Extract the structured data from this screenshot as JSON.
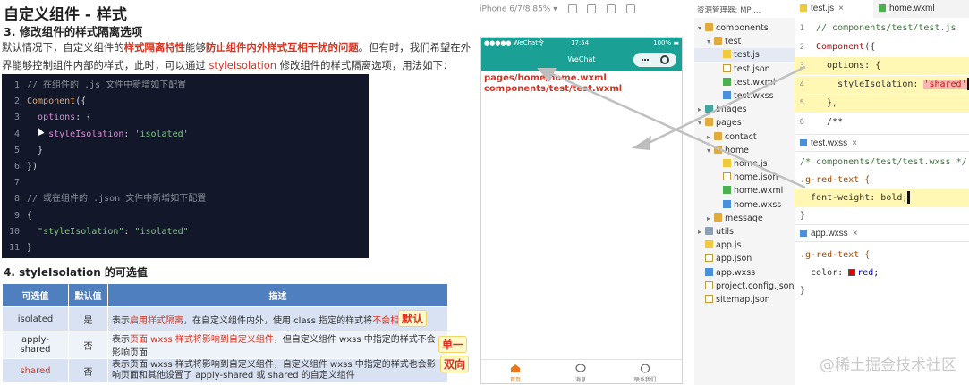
{
  "slide": {
    "title": "自定义组件 - 样式",
    "section3": "3. 修改组件的样式隔离选项",
    "para_a": "默认情况下，自定义组件的",
    "para_hl1": "样式隔离特性",
    "para_b": "能够",
    "para_hl2": "防止组件内外样式互相干扰的问题",
    "para_c": "。但有时，我们希望在外界能够控制组件内部的样式，此时，可以通过 ",
    "para_hl3": "styleIsolation",
    "para_d": " 修改组件的样式隔离选项，用法如下：",
    "code_lines": [
      {
        "n": "1",
        "parts": [
          {
            "c": "tk-cm",
            "t": "// 在组件的 .js 文件中新增如下配置"
          }
        ]
      },
      {
        "n": "2",
        "parts": [
          {
            "c": "tk-kw",
            "t": "Component"
          },
          {
            "c": "tk-pl",
            "t": "({"
          }
        ]
      },
      {
        "n": "3",
        "parts": [
          {
            "c": "tk-pl",
            "t": "  "
          },
          {
            "c": "tk-prop",
            "t": "options"
          },
          {
            "c": "tk-pl",
            "t": ": {"
          }
        ]
      },
      {
        "n": "4",
        "parts": [
          {
            "c": "tk-pl",
            "t": "    "
          },
          {
            "c": "tk-prop",
            "t": "styleIsolation"
          },
          {
            "c": "tk-pl",
            "t": ": "
          },
          {
            "c": "tk-str",
            "t": "'isolated'"
          }
        ]
      },
      {
        "n": "5",
        "parts": [
          {
            "c": "tk-pl",
            "t": "  }"
          }
        ]
      },
      {
        "n": "6",
        "parts": [
          {
            "c": "tk-pl",
            "t": "})"
          }
        ]
      },
      {
        "n": "7",
        "parts": []
      },
      {
        "n": "8",
        "parts": [
          {
            "c": "tk-cm",
            "t": "// 或在组件的 .json 文件中新增如下配置"
          }
        ]
      },
      {
        "n": "9",
        "parts": [
          {
            "c": "tk-pl",
            "t": "{"
          }
        ]
      },
      {
        "n": "10",
        "parts": [
          {
            "c": "tk-pl",
            "t": "  "
          },
          {
            "c": "tk-str",
            "t": "\"styleIsolation\""
          },
          {
            "c": "tk-pl",
            "t": ": "
          },
          {
            "c": "tk-str",
            "t": "\"isolated\""
          }
        ]
      },
      {
        "n": "11",
        "parts": [
          {
            "c": "tk-pl",
            "t": "}"
          }
        ]
      }
    ],
    "section4": "4. styleIsolation 的可选值",
    "table": {
      "headers": [
        "可选值",
        "默认值",
        "描述"
      ],
      "rows": [
        {
          "value": "isolated",
          "default": "是",
          "desc_a": "表示",
          "desc_red1": "启用样式隔离",
          "desc_b": "，在自定义组件内外，使用 class 指定的样式将",
          "desc_red2": "不会相互影响",
          "tag": "默认"
        },
        {
          "value": "apply-shared",
          "default": "否",
          "desc_a": "表示",
          "desc_red1": "页面 wxss 样式将影响到自定义组件",
          "desc_b": "，但自定义组件 wxss 中指定的样式不会影响页面",
          "desc_red2": "",
          "tag": "单一"
        },
        {
          "value": "shared",
          "default": "否",
          "desc_a": "表示页面 wxss 样式将影响到自定义组件，自定义组件 wxss 中指定的样式也会影响页面和其他设置了 apply-shared 或 shared 的自定义组件",
          "desc_red1": "",
          "desc_b": "",
          "desc_red2": "",
          "tag": "双向"
        }
      ]
    }
  },
  "simulator": {
    "device": "iPhone 6/7/8 85% ▾",
    "status_left": "●●●●● WeChat令",
    "status_time": "17:54",
    "status_right": "100% ▬",
    "nav_title": "WeChat",
    "line1": "pages/home/home.wxml",
    "line2": "components/test/test.wxml",
    "tabs": [
      {
        "label": "首页",
        "icon": "home-icon",
        "active": true
      },
      {
        "label": "消息",
        "icon": "message-icon",
        "active": false
      },
      {
        "label": "联系我们",
        "icon": "phone-icon",
        "active": false
      }
    ]
  },
  "tree": {
    "header": "资源管理器: MP ...",
    "items": [
      {
        "label": "components",
        "icon": "folder",
        "depth": 0,
        "chev": "▾"
      },
      {
        "label": "test",
        "icon": "folder",
        "depth": 1,
        "chev": "▾"
      },
      {
        "label": "test.js",
        "icon": "js",
        "depth": 2,
        "chev": "",
        "selected": true
      },
      {
        "label": "test.json",
        "icon": "json",
        "depth": 2,
        "chev": ""
      },
      {
        "label": "test.wxml",
        "icon": "wxml",
        "depth": 2,
        "chev": ""
      },
      {
        "label": "test.wxss",
        "icon": "wxss",
        "depth": 2,
        "chev": ""
      },
      {
        "label": "images",
        "icon": "folder teal",
        "depth": 0,
        "chev": "▸"
      },
      {
        "label": "pages",
        "icon": "folder",
        "depth": 0,
        "chev": "▾"
      },
      {
        "label": "contact",
        "icon": "folder",
        "depth": 1,
        "chev": "▸"
      },
      {
        "label": "home",
        "icon": "folder",
        "depth": 1,
        "chev": "▾"
      },
      {
        "label": "home.js",
        "icon": "js",
        "depth": 2,
        "chev": ""
      },
      {
        "label": "home.json",
        "icon": "json",
        "depth": 2,
        "chev": ""
      },
      {
        "label": "home.wxml",
        "icon": "wxml",
        "depth": 2,
        "chev": ""
      },
      {
        "label": "home.wxss",
        "icon": "wxss",
        "depth": 2,
        "chev": ""
      },
      {
        "label": "message",
        "icon": "folder",
        "depth": 1,
        "chev": "▸"
      },
      {
        "label": "utils",
        "icon": "folder gray",
        "depth": 0,
        "chev": "▸"
      },
      {
        "label": "app.js",
        "icon": "js",
        "depth": 0,
        "chev": ""
      },
      {
        "label": "app.json",
        "icon": "json",
        "depth": 0,
        "chev": ""
      },
      {
        "label": "app.wxss",
        "icon": "wxss",
        "depth": 0,
        "chev": ""
      },
      {
        "label": "project.config.json",
        "icon": "json",
        "depth": 0,
        "chev": ""
      },
      {
        "label": "sitemap.json",
        "icon": "json",
        "depth": 0,
        "chev": ""
      }
    ]
  },
  "editor": {
    "tab1": "test.js",
    "tab2": "home.wxml",
    "js_lines": [
      {
        "n": "1",
        "parts": [
          {
            "c": "c-cm",
            "t": "// components/test/test.js"
          }
        ],
        "yl": false
      },
      {
        "n": "2",
        "parts": [
          {
            "c": "c-fn",
            "t": "Component"
          },
          {
            "c": "c-prop",
            "t": "({"
          }
        ],
        "yl": false
      },
      {
        "n": "3",
        "parts": [
          {
            "c": "c-prop",
            "t": "  options: {"
          }
        ],
        "yl": true
      },
      {
        "n": "4",
        "parts": [
          {
            "c": "c-prop",
            "t": "    styleIsolation: "
          },
          {
            "c": "c-str",
            "t": "'shared'"
          }
        ],
        "yl": true,
        "caret": true
      },
      {
        "n": "5",
        "parts": [
          {
            "c": "c-prop",
            "t": "  },"
          }
        ],
        "yl": true
      },
      {
        "n": "6",
        "parts": [
          {
            "c": "c-prop",
            "t": "  /**"
          }
        ],
        "yl": false
      }
    ],
    "wxss_tab": "test.wxss",
    "wxss_lines": [
      {
        "parts": [
          {
            "c": "c-cm",
            "t": "/* components/test/test.wxss */"
          }
        ],
        "yl": false
      },
      {
        "parts": [
          {
            "c": "c-sel",
            "t": ".g-red-text {"
          }
        ],
        "yl": false
      },
      {
        "parts": [
          {
            "c": "c-prop",
            "t": "  font-weight: bold;"
          }
        ],
        "yl": true,
        "caret": true
      },
      {
        "parts": [
          {
            "c": "c-prop",
            "t": "}"
          }
        ],
        "yl": false
      }
    ],
    "app_tab": "app.wxss",
    "app_lines": [
      {
        "parts": [
          {
            "c": "c-sel",
            "t": ".g-red-text {"
          }
        ],
        "yl": false
      },
      {
        "parts": [
          {
            "c": "c-prop",
            "t": "  color: "
          },
          {
            "c": "c-kw",
            "t": "red;"
          }
        ],
        "yl": false,
        "swatch": true
      },
      {
        "parts": [
          {
            "c": "c-prop",
            "t": "}"
          }
        ],
        "yl": false
      }
    ]
  },
  "watermark": "@稀土掘金技术社区"
}
